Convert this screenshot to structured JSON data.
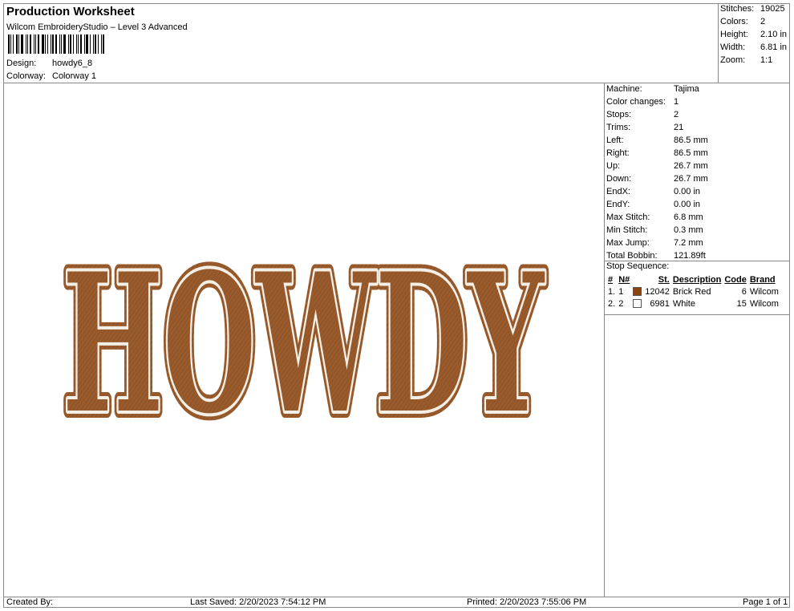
{
  "header": {
    "title": "Production Worksheet",
    "software": "Wilcom EmbroideryStudio – Level 3 Advanced",
    "design_label": "Design:",
    "design_value": "howdy6_8",
    "colorway_label": "Colorway:",
    "colorway_value": "Colorway 1"
  },
  "summary": [
    {
      "label": "Stitches:",
      "value": "19025"
    },
    {
      "label": "Colors:",
      "value": "2"
    },
    {
      "label": "Height:",
      "value": "2.10 in"
    },
    {
      "label": "Width:",
      "value": "6.81 in"
    },
    {
      "label": "Zoom:",
      "value": "1:1"
    }
  ],
  "details": [
    {
      "label": "Machine:",
      "value": "Tajima"
    },
    {
      "label": "Color changes:",
      "value": "1"
    },
    {
      "label": "Stops:",
      "value": "2"
    },
    {
      "label": "Trims:",
      "value": "21"
    },
    {
      "label": "Left:",
      "value": "86.5 mm"
    },
    {
      "label": "Right:",
      "value": "86.5 mm"
    },
    {
      "label": "Up:",
      "value": "26.7 mm"
    },
    {
      "label": "Down:",
      "value": "26.7 mm"
    },
    {
      "label": "EndX:",
      "value": "0.00 in"
    },
    {
      "label": "EndY:",
      "value": "0.00 in"
    },
    {
      "label": "Max Stitch:",
      "value": "6.8 mm"
    },
    {
      "label": "Min Stitch:",
      "value": "0.3 mm"
    },
    {
      "label": "Max Jump:",
      "value": "7.2 mm"
    },
    {
      "label": "Total Bobbin:",
      "value": "121.89ft"
    }
  ],
  "stop_sequence": {
    "title": "Stop Sequence:",
    "headers": [
      "#",
      "N#",
      "St.",
      "Description",
      "Code",
      "Brand"
    ],
    "rows": [
      {
        "num": "1.",
        "n": "1",
        "color": "#8B4513",
        "st": "12042",
        "description": "Brick Red",
        "code": "6",
        "brand": "Wilcom"
      },
      {
        "num": "2.",
        "n": "2",
        "color": "#FFFFFF",
        "st": "6981",
        "description": "White",
        "code": "15",
        "brand": "Wilcom"
      }
    ]
  },
  "design_preview": {
    "text": "HOWDY",
    "fill_color": "#9A5B2C",
    "outline_color": "#F4EFE6"
  },
  "footer": {
    "created_by": "Created By:",
    "last_saved": "Last Saved: 2/20/2023 7:54:12 PM",
    "printed": "Printed: 2/20/2023 7:55:06 PM",
    "page": "Page 1 of 1"
  }
}
